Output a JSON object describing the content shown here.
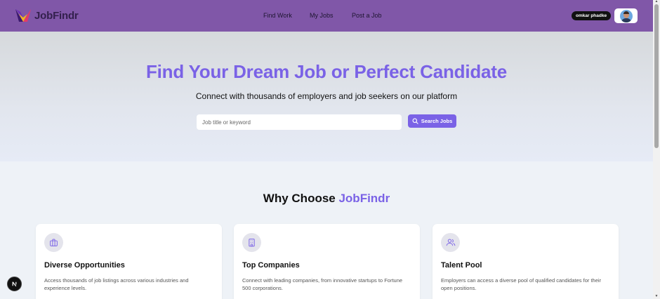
{
  "brand": {
    "name": "JobFindr"
  },
  "nav": {
    "links": [
      {
        "label": "Find Work"
      },
      {
        "label": "My Jobs"
      },
      {
        "label": "Post a Job"
      }
    ],
    "user_name": "omkar phadke"
  },
  "hero": {
    "title": "Find Your Dream Job or Perfect Candidate",
    "subtitle": "Connect with thousands of employers and job seekers on our platform",
    "search_placeholder": "Job title or keyword",
    "search_value": "",
    "search_button": "Search Jobs"
  },
  "features": {
    "title_prefix": "Why Choose ",
    "title_accent": "JobFindr",
    "cards": [
      {
        "icon": "briefcase-icon",
        "title": "Diverse Opportunities",
        "description": "Access thousands of job listings across various industries and experience levels."
      },
      {
        "icon": "building-icon",
        "title": "Top Companies",
        "description": "Connect with leading companies, from innovative startups to Fortune 500 corporations."
      },
      {
        "icon": "users-icon",
        "title": "Talent Pool",
        "description": "Employers can access a diverse pool of qualified candidates for their open positions."
      }
    ]
  },
  "colors": {
    "navbar": "#8057a8",
    "accent": "#7a62e6",
    "page_background": "#eef2f7"
  }
}
